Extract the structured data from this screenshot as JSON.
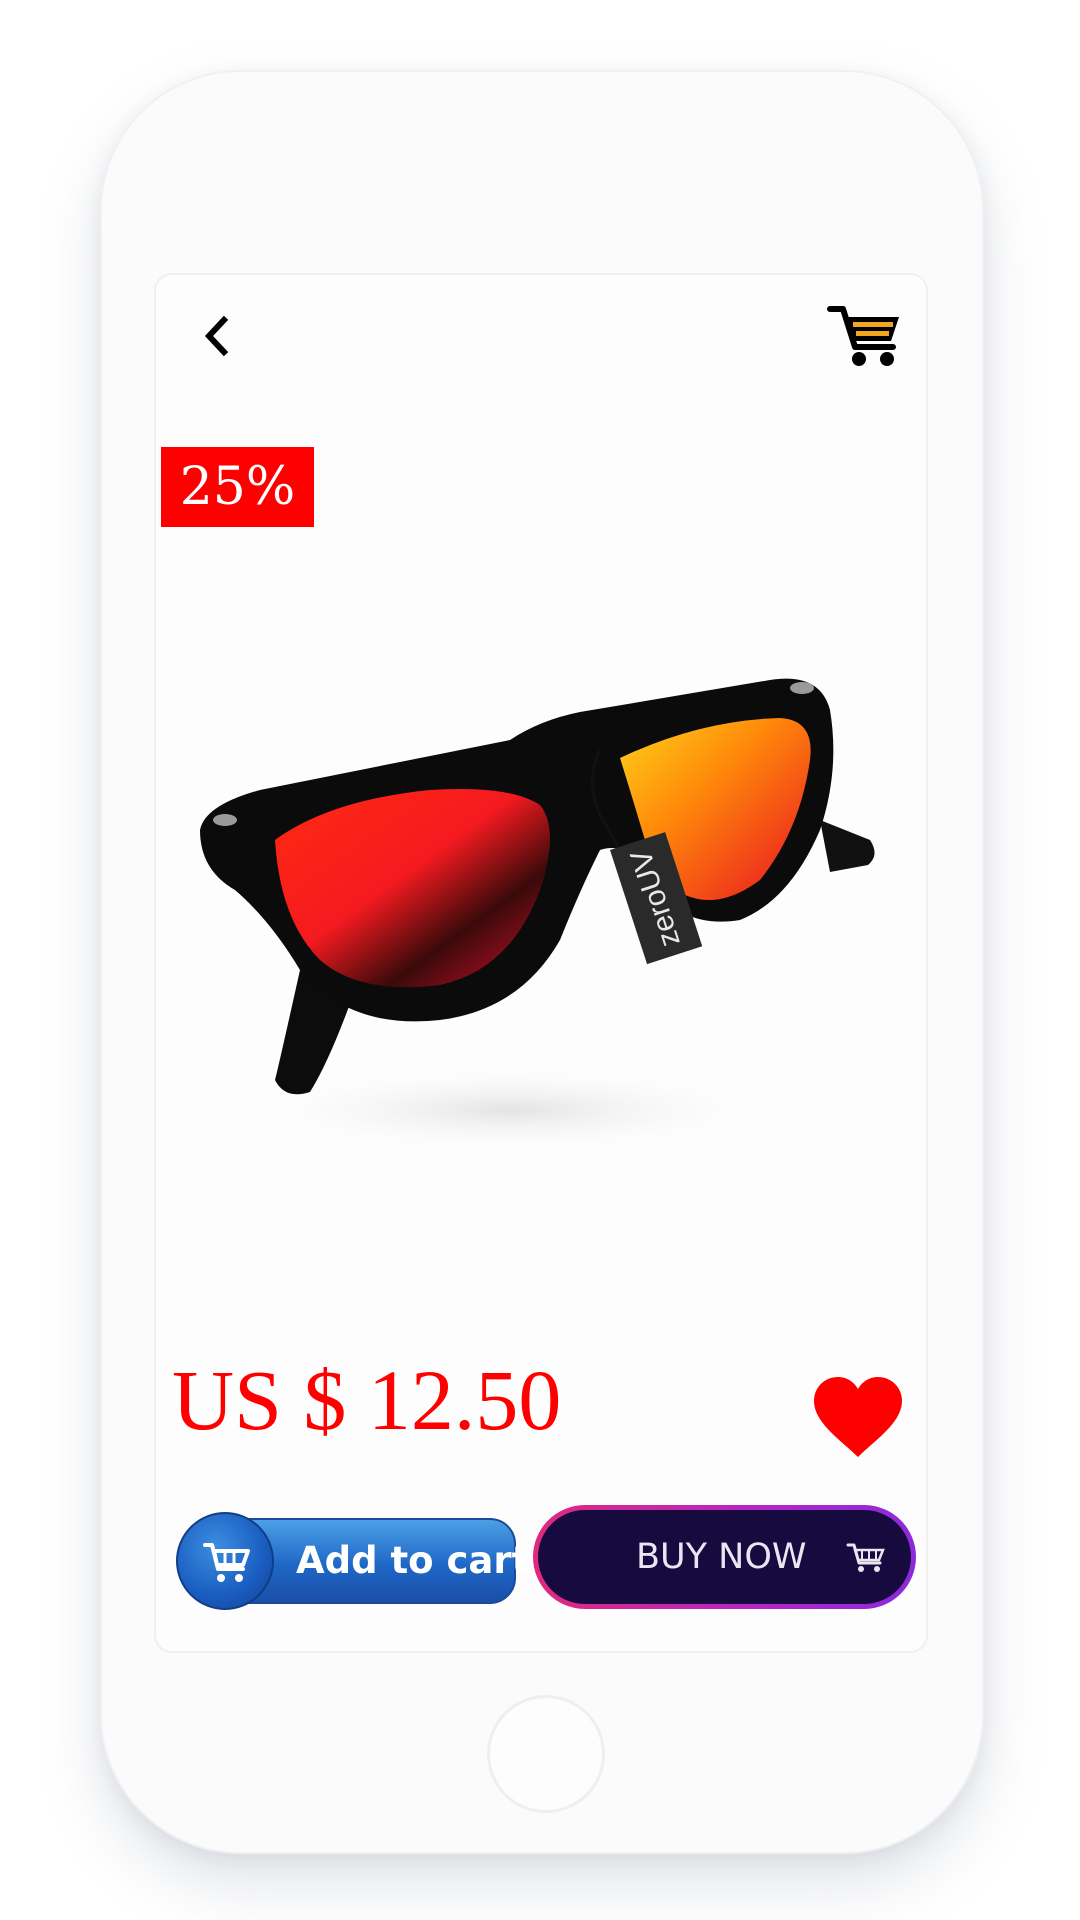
{
  "product": {
    "discount_badge": "25%",
    "price": "US $ 12.50",
    "tag_brand": "zeroUV",
    "image_icon": "sunglasses-image"
  },
  "actions": {
    "add_to_cart_label": "Add to cart",
    "buy_now_label": "BUY NOW"
  },
  "icons": {
    "back": "chevron-left-icon",
    "cart": "shopping-cart-icon",
    "favorite": "heart-icon"
  },
  "colors": {
    "accent_red": "#fe0000",
    "add_to_cart_blue": "#1f67c6",
    "buy_now_bg": "#160a3e",
    "buy_now_border": "#d12a95"
  }
}
